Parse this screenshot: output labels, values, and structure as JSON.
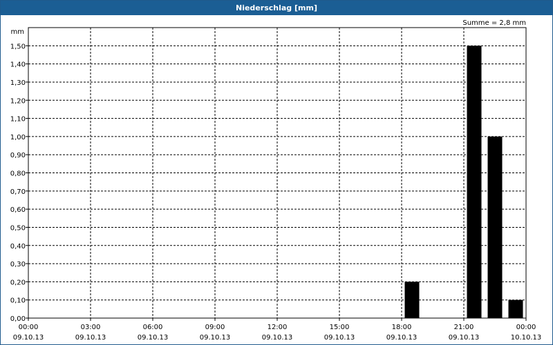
{
  "window": {
    "title": "Niederschlag [mm]"
  },
  "chart_data": {
    "type": "bar",
    "title": "Niederschlag [mm]",
    "ylabel": "mm",
    "annotation": "Summe = 2,8 mm",
    "ylim": [
      0,
      1.6
    ],
    "y_ticks": [
      "0,00",
      "0,10",
      "0,20",
      "0,30",
      "0,40",
      "0,50",
      "0,60",
      "0,70",
      "0,80",
      "0,90",
      "1,00",
      "1,10",
      "1,20",
      "1,30",
      "1,40",
      "1,50"
    ],
    "x_range_hours": [
      0,
      24
    ],
    "x_ticks": [
      {
        "time": "00:00",
        "date": "09.10.13"
      },
      {
        "time": "03:00",
        "date": "09.10.13"
      },
      {
        "time": "06:00",
        "date": "09.10.13"
      },
      {
        "time": "09:00",
        "date": "09.10.13"
      },
      {
        "time": "12:00",
        "date": "09.10.13"
      },
      {
        "time": "15:00",
        "date": "09.10.13"
      },
      {
        "time": "18:00",
        "date": "09.10.13"
      },
      {
        "time": "21:00",
        "date": "09.10.13"
      },
      {
        "time": "00:00",
        "date": "10.10.13"
      }
    ],
    "series": [
      {
        "x": [
          "09.10.13 18:00",
          "09.10.13 21:00",
          "09.10.13 22:00",
          "09.10.13 23:00"
        ],
        "values": [
          0.2,
          1.5,
          1.0,
          0.1
        ]
      }
    ],
    "grid": true,
    "colors": {
      "bar": "#000000",
      "grid": "#000000",
      "title_bar": "#1b5e94"
    }
  }
}
